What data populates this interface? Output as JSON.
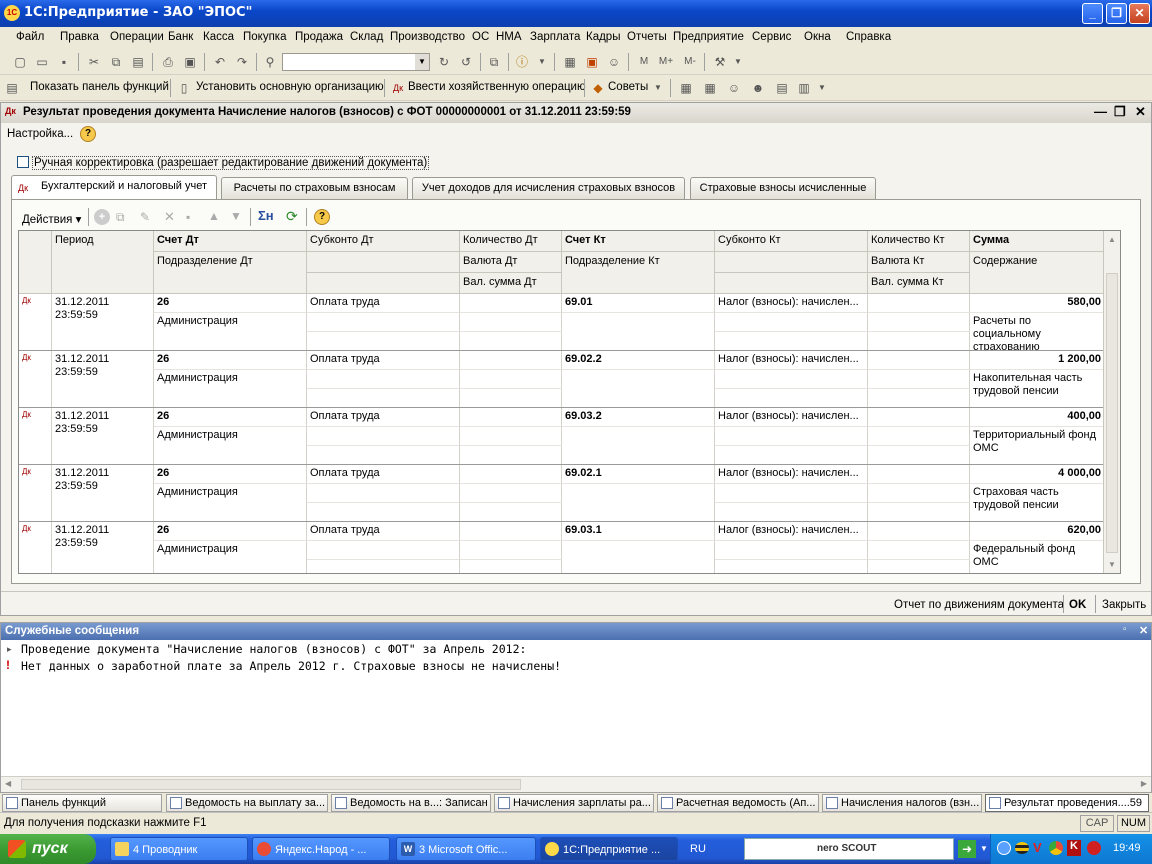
{
  "window": {
    "title": "1С:Предприятие - ЗАО \"ЭПОС\""
  },
  "menu": [
    "Файл",
    "Правка",
    "Операции",
    "Банк",
    "Касса",
    "Покупка",
    "Продажа",
    "Склад",
    "Производство",
    "ОС",
    "НМА",
    "Зарплата",
    "Кадры",
    "Отчеты",
    "Предприятие",
    "Сервис",
    "Окна",
    "Справка"
  ],
  "toolbar2": {
    "show_panel": "Показать панель функций",
    "set_org": "Установить основную организацию",
    "enter_op": "Ввести хозяйственную операцию",
    "tips": "Советы"
  },
  "doc": {
    "title": "Результат проведения документа Начисление налогов (взносов) с ФОТ 00000000001 от 31.12.2011 23:59:59",
    "settings": "Настройка...",
    "manual_checkbox": "Ручная корректировка (разрешает редактирование движений документа)",
    "tabs": [
      "Бухгалтерский и налоговый учет",
      "Расчеты по страховым взносам",
      "Учет доходов для исчисления страховых взносов",
      "Страховые взносы исчисленные"
    ],
    "actions": "Действия",
    "headers": {
      "period": "Период",
      "schet_dt": "Счет Дт",
      "subkonto_dt": "Субконто Дт",
      "kol_dt": "Количество Дт",
      "schet_kt": "Счет Кт",
      "subkonto_kt": "Субконто Кт",
      "kol_kt": "Количество Кт",
      "summa": "Сумма",
      "podr_dt": "Подразделение Дт",
      "val_dt": "Валюта Дт",
      "valsum_dt": "Вал. сумма Дт",
      "podr_kt": "Подразделение Кт",
      "val_kt": "Валюта Кт",
      "valsum_kt": "Вал. сумма Кт",
      "soderzhanie": "Содержание"
    },
    "rows": [
      {
        "date": "31.12.2011",
        "time": "23:59:59",
        "schet_dt": "26",
        "podr_dt": "Администрация",
        "subkonto_dt": "Оплата труда",
        "schet_kt": "69.01",
        "subkonto_kt": "Налог (взносы): начислен...",
        "summa": "580,00",
        "soderzhanie": "Расчеты по социальному страхованию"
      },
      {
        "date": "31.12.2011",
        "time": "23:59:59",
        "schet_dt": "26",
        "podr_dt": "Администрация",
        "subkonto_dt": "Оплата труда",
        "schet_kt": "69.02.2",
        "subkonto_kt": "Налог (взносы): начислен...",
        "summa": "1 200,00",
        "soderzhanie": "Накопительная часть трудовой пенсии"
      },
      {
        "date": "31.12.2011",
        "time": "23:59:59",
        "schet_dt": "26",
        "podr_dt": "Администрация",
        "subkonto_dt": "Оплата труда",
        "schet_kt": "69.03.2",
        "subkonto_kt": "Налог (взносы): начислен...",
        "summa": "400,00",
        "soderzhanie": "Территориальный фонд ОМС"
      },
      {
        "date": "31.12.2011",
        "time": "23:59:59",
        "schet_dt": "26",
        "podr_dt": "Администрация",
        "subkonto_dt": "Оплата труда",
        "schet_kt": "69.02.1",
        "subkonto_kt": "Налог (взносы): начислен...",
        "summa": "4 000,00",
        "soderzhanie": "Страховая часть трудовой пенсии"
      },
      {
        "date": "31.12.2011",
        "time": "23:59:59",
        "schet_dt": "26",
        "podr_dt": "Администрация",
        "subkonto_dt": "Оплата труда",
        "schet_kt": "69.03.1",
        "subkonto_kt": "Налог (взносы): начислен...",
        "summa": "620,00",
        "soderzhanie": "Федеральный фонд ОМС"
      }
    ],
    "footer": {
      "report": "Отчет по движениям документа",
      "ok": "OK",
      "close": "Закрыть"
    }
  },
  "messages": {
    "title": "Служебные сообщения",
    "lines": [
      "Проведение документа \"Начисление налогов (взносов) с ФОТ\" за Апрель 2012:",
      "Нет данных о заработной плате за Апрель 2012 г. Страховые взносы не начислены!"
    ]
  },
  "open_windows": [
    "Панель функций",
    "Ведомость на выплату за...",
    "Ведомость на в...: Записан",
    "Начисления зарплаты ра...",
    "Расчетная ведомость (Ап...",
    "Начисления налогов (взн...",
    "Результат проведения....59"
  ],
  "status": {
    "hint": "Для получения подсказки нажмите F1",
    "caps": "CAP",
    "num": "NUM"
  },
  "taskbar": {
    "start": "пуск",
    "items": [
      "4 Проводник",
      "Яндекс.Народ - ...",
      "3 Microsoft Offic...",
      "1С:Предприятие ..."
    ],
    "lang": "RU",
    "nero": "nero SCOUT",
    "clock": "19:49"
  }
}
